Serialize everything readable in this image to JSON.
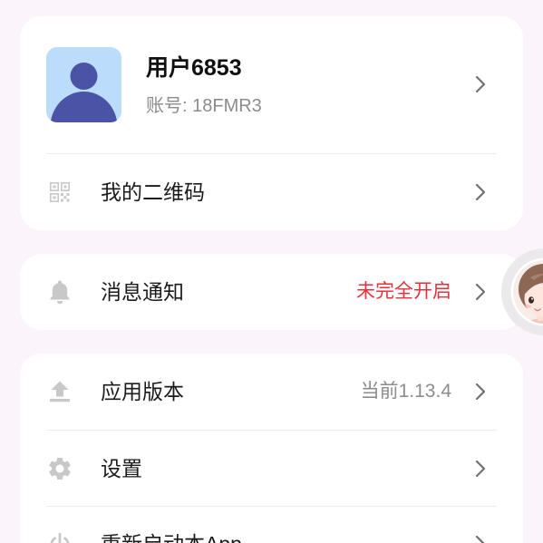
{
  "profile": {
    "name": "用户6853",
    "account": "账号: 18FMR3",
    "avatar_icon": "default-user-avatar-icon",
    "chevron_icon": "chevron-right-icon"
  },
  "qr_row": {
    "label": "我的二维码",
    "icon": "qr-code-icon"
  },
  "notification_row": {
    "label": "消息通知",
    "status": "未完全开启",
    "icon": "bell-icon"
  },
  "version_row": {
    "label": "应用版本",
    "value": "当前1.13.4",
    "icon": "upload-icon"
  },
  "settings_row": {
    "label": "设置",
    "icon": "gear-icon"
  },
  "restart_row": {
    "label": "重新启动本App",
    "icon": "power-icon"
  },
  "floating_button": {
    "icon": "assistant-avatar-icon"
  },
  "colors": {
    "background": "#fbf4fa",
    "card": "#ffffff",
    "primary_text": "#1b1b1b",
    "secondary_text": "#8c8c8c",
    "status_warning": "#e3323b",
    "icon": "#c8c8c8",
    "chevron": "#707070",
    "avatar_background": "#bcdcfb",
    "avatar_figure": "#4a53a6"
  }
}
